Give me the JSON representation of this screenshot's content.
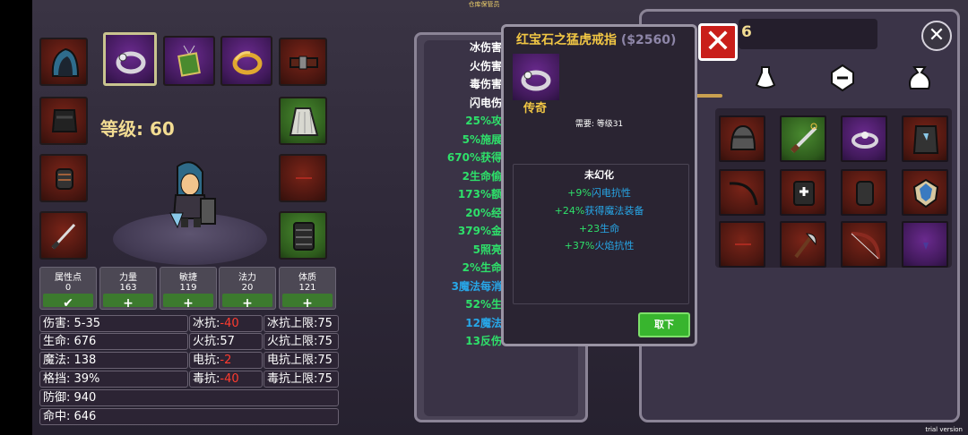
{
  "top_hint": "仓库保管员",
  "trial_label": "trial version",
  "level_text": "等级: 60",
  "attributes": [
    {
      "label": "属性点",
      "value": "0",
      "button": "check"
    },
    {
      "label": "力量",
      "value": "163",
      "button": "plus"
    },
    {
      "label": "敏捷",
      "value": "119",
      "button": "plus"
    },
    {
      "label": "法力",
      "value": "20",
      "button": "plus"
    },
    {
      "label": "体质",
      "value": "121",
      "button": "plus"
    }
  ],
  "stats": {
    "damage": "伤害: 5-35",
    "life": "生命: 676",
    "mana": "魔法: 138",
    "block": "格挡: 39%",
    "defense": "防御: 940",
    "hit": "命中: 646",
    "cold_res_label": "冰抗:",
    "cold_res_value": "-40",
    "cold_cap": "冰抗上限:75",
    "fire_res": "火抗:57",
    "fire_cap": "火抗上限:75",
    "light_res_label": "电抗:",
    "light_res_value": "-2",
    "light_cap": "电抗上限:75",
    "poison_res_label": "毒抗:",
    "poison_res_value": "-40",
    "poison_cap": "毒抗上限:75"
  },
  "middle_lines": [
    {
      "text": "冰伤害",
      "color": "white"
    },
    {
      "text": "火伤害",
      "color": "white"
    },
    {
      "text": "毒伤害",
      "color": "white"
    },
    {
      "text": "闪电伤",
      "color": "white"
    },
    {
      "text": "25%攻",
      "color": "green"
    },
    {
      "text": "5%施展",
      "color": "green"
    },
    {
      "text": "670%获得",
      "color": "green"
    },
    {
      "text": "2生命偷",
      "color": "green"
    },
    {
      "text": "173%额",
      "color": "green"
    },
    {
      "text": "20%经",
      "color": "green"
    },
    {
      "text": "379%金",
      "color": "green"
    },
    {
      "text": "5照亮",
      "color": "green"
    },
    {
      "text": "2%生命",
      "color": "green"
    },
    {
      "text": "3魔法每消",
      "color": "blue"
    },
    {
      "text": "52%生",
      "color": "green"
    },
    {
      "text": "12魔法",
      "color": "blue"
    },
    {
      "text": "13反伤",
      "color": "green"
    }
  ],
  "right_panel": {
    "gold_partial": "6",
    "close_glyph": "✕"
  },
  "tooltip": {
    "title": "红宝石之猛虎戒指",
    "price": "($2560)",
    "rarity": "传奇",
    "requirement": "需要: 等级31",
    "subtitle": "未幻化",
    "lines": [
      {
        "pre": "+9%",
        "post": "闪电抗性"
      },
      {
        "pre": "+24%",
        "post": "获得魔法装备"
      },
      {
        "pre": "+23",
        "post": "生命"
      },
      {
        "pre": "+37%",
        "post": "火焰抗性"
      }
    ],
    "unequip": "取下"
  },
  "colors": {
    "gold": "#f2dc92",
    "green": "#2ee06a",
    "blue": "#27a7e8",
    "negative": "#ff3b2f",
    "close_red": "#c91e1a"
  }
}
